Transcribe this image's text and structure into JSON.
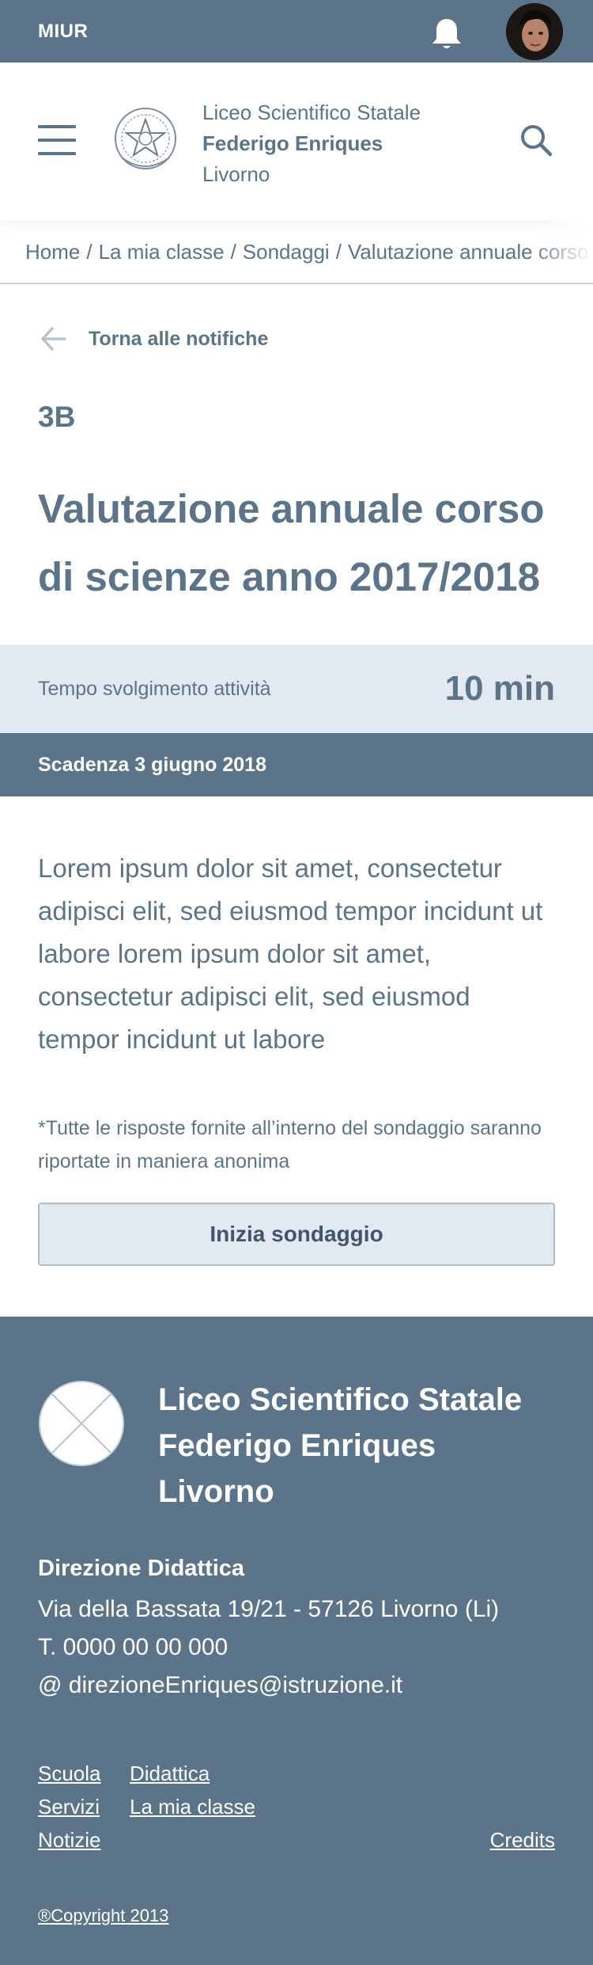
{
  "topbar": {
    "brand": "MIUR"
  },
  "header": {
    "school_line1": "Liceo Scientifico Statale",
    "school_line2": "Federigo Enriques",
    "school_line3": "Livorno"
  },
  "breadcrumb": {
    "items": [
      "Home",
      "La mia classe",
      "Sondaggi",
      "Valutazione annuale corso"
    ],
    "separator": "/"
  },
  "back": {
    "label": "Torna alle notifiche"
  },
  "survey": {
    "class": "3B",
    "title": "Valutazione annuale corso di scienze anno 2017/2018",
    "time_label": "Tempo svolgimento attività",
    "time_value": "10 min",
    "deadline": "Scadenza 3 giugno 2018",
    "description": "Lorem ipsum dolor sit amet, consectetur adipisci elit, sed eiusmod tempor incidunt ut labore lorem ipsum dolor sit amet, consectetur adipisci elit, sed eiusmod tempor incidunt ut labore",
    "note": "*Tutte le risposte fornite all’interno del sondaggio saranno riportate in maniera anonima",
    "start_button": "Inizia sondaggio"
  },
  "footer": {
    "school_line1": "Liceo Scientifico Statale",
    "school_line2": "Federigo Enriques",
    "school_line3": "Livorno",
    "direction_title": "Direzione Didattica",
    "address": "Via della Bassata 19/21 - 57126 Livorno (Li)",
    "phone": "T. 0000 00 00 000",
    "email": "@ direzioneEnriques@istruzione.it",
    "links_col1": [
      "Scuola",
      "Servizi",
      "Notizie"
    ],
    "links_col2": [
      "Didattica",
      "La mia classe"
    ],
    "credits": "Credits",
    "copyright": "®Copyright 2013"
  },
  "colors": {
    "primary": "#5c7489",
    "light_band": "#e3e9f0",
    "border": "#c5d2de"
  },
  "icons": {
    "notification": "bell-icon",
    "menu": "hamburger-icon",
    "search": "search-icon",
    "back": "arrow-left-icon",
    "emblem": "emblem-icon",
    "footer_logo": "placeholder-logo-icon"
  }
}
